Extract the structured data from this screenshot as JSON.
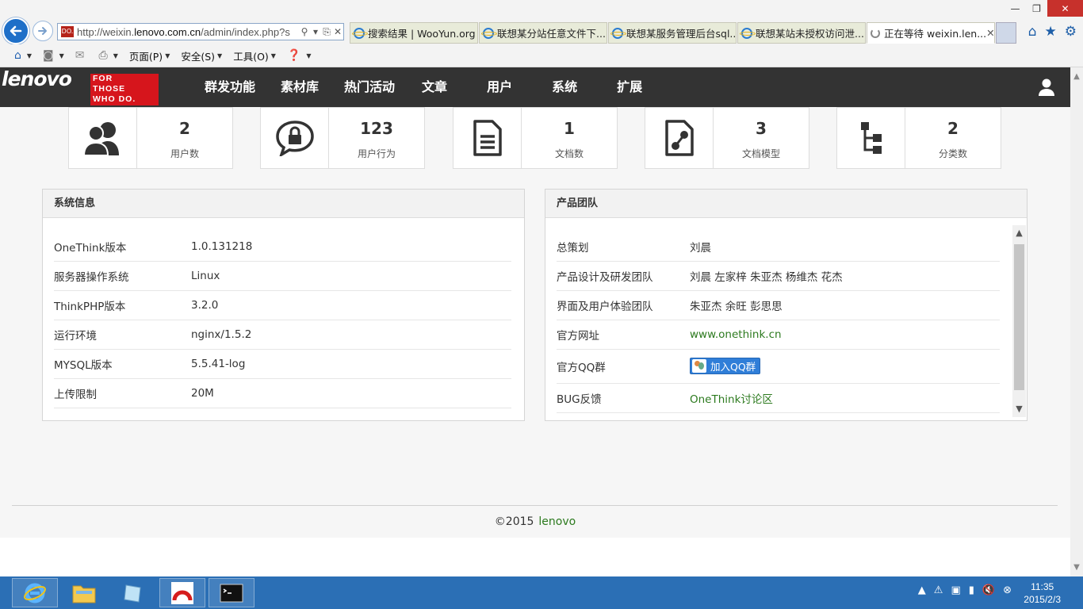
{
  "browser": {
    "url_prefix": "http://weixin.",
    "url_domain": "lenovo.com.cn",
    "url_path": "/admin/index.php?s",
    "favicon_text": "DO.",
    "tabs": [
      {
        "label": "搜索结果 | WooYun.org"
      },
      {
        "label": "联想某分站任意文件下..."
      },
      {
        "label": "联想某服务管理后台sql..."
      },
      {
        "label": "联想某站未授权访问泄..."
      },
      {
        "label": "正在等待 weixin.len..."
      }
    ],
    "command_bar": {
      "page_menu": "页面(P)",
      "safety_menu": "安全(S)",
      "tools_menu": "工具(O)"
    }
  },
  "site": {
    "logo_word": "lenovo",
    "logo_tag": [
      "FOR",
      "THOSE",
      "WHO DO."
    ],
    "menu": [
      "群发功能",
      "素材库",
      "热门活动",
      "文章",
      "用户",
      "系统",
      "扩展"
    ]
  },
  "stats": [
    {
      "value": "2",
      "label": "用户数",
      "icon": "users-icon"
    },
    {
      "value": "123",
      "label": "用户行为",
      "icon": "lock-chat-icon"
    },
    {
      "value": "1",
      "label": "文档数",
      "icon": "document-icon"
    },
    {
      "value": "3",
      "label": "文档模型",
      "icon": "document-model-icon"
    },
    {
      "value": "2",
      "label": "分类数",
      "icon": "category-tree-icon"
    }
  ],
  "system_info": {
    "title": "系统信息",
    "rows": [
      {
        "key": "OneThink版本",
        "value": "1.0.131218"
      },
      {
        "key": "服务器操作系统",
        "value": "Linux"
      },
      {
        "key": "ThinkPHP版本",
        "value": "3.2.0"
      },
      {
        "key": "运行环境",
        "value": "nginx/1.5.2"
      },
      {
        "key": "MYSQL版本",
        "value": "5.5.41-log"
      },
      {
        "key": "上传限制",
        "value": "20M"
      }
    ]
  },
  "team": {
    "title": "产品团队",
    "rows": [
      {
        "key": "总策划",
        "value": "刘晨"
      },
      {
        "key": "产品设计及研发团队",
        "value": "刘晨 左家梓 朱亚杰 杨维杰 花杰"
      },
      {
        "key": "界面及用户体验团队",
        "value": "朱亚杰 余旺 彭思思"
      },
      {
        "key": "官方网址",
        "value": "www.onethink.cn"
      },
      {
        "key": "官方QQ群",
        "value": "加入QQ群"
      },
      {
        "key": "BUG反馈",
        "value": "OneThink讨论区"
      }
    ]
  },
  "footer": {
    "copyright": "©2015",
    "brand": "lenovo"
  },
  "clock": {
    "time": "11:35",
    "date": "2015/2/3"
  },
  "colors": {
    "nav_bg": "#333333",
    "link_green": "#2c7a1e",
    "lenovo_red": "#d6151c",
    "taskbar": "#2b6fb5"
  }
}
